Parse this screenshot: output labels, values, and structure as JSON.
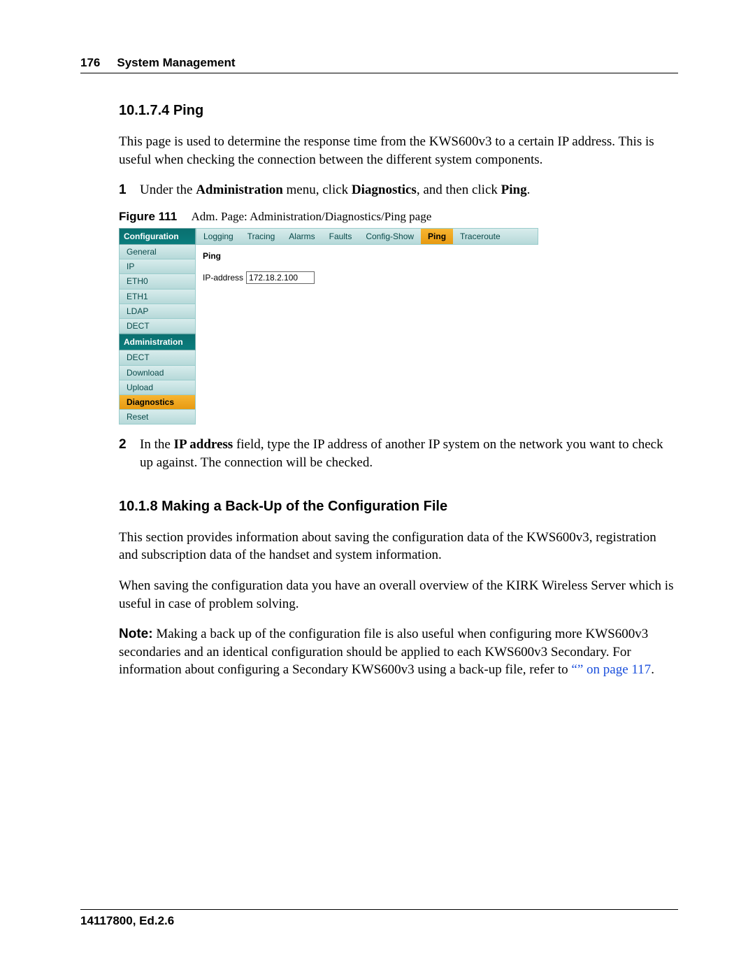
{
  "header": {
    "page_number": "176",
    "chapter_title": "System Management"
  },
  "section_ping": {
    "heading": "10.1.7.4  Ping",
    "intro": "This page is used to determine the response time from the KWS600v3 to a certain IP address. This is useful when checking the connection between the different system components.",
    "step1_pre": "Under the ",
    "step1_b1": "Administration",
    "step1_mid1": " menu, click ",
    "step1_b2": "Diagnostics",
    "step1_mid2": ", and then click ",
    "step1_b3": "Ping",
    "step1_end": ".",
    "figure_label": "Figure 111",
    "figure_caption": "Adm. Page: Administration/Diagnostics/Ping page",
    "step2_pre": "In the ",
    "step2_b": "IP address",
    "step2_post": " field, type the IP address of another IP system on the network you want to check up against. The connection will be checked."
  },
  "admin_ui": {
    "sidebar": {
      "config_header": "Configuration",
      "config_items": [
        "General",
        "IP",
        "ETH0",
        "ETH1",
        "LDAP",
        "DECT"
      ],
      "admin_header": "Administration",
      "admin_items": [
        "DECT",
        "Download",
        "Upload",
        "Diagnostics",
        "Reset"
      ],
      "selected": "Diagnostics"
    },
    "tabs": [
      "Logging",
      "Tracing",
      "Alarms",
      "Faults",
      "Config-Show",
      "Ping",
      "Traceroute"
    ],
    "active_tab": "Ping",
    "panel_title": "Ping",
    "ip_label": "IP-address",
    "ip_value": "172.18.2.100"
  },
  "section_backup": {
    "heading": "10.1.8  Making a Back-Up of the Configuration File",
    "p1": "This section provides information about saving the configuration data of the KWS600v3, registration and subscription data of the handset and system information.",
    "p2": "When saving the configuration data you have an overall overview of the KIRK Wireless Server which is useful in case of problem solving.",
    "note_label": "Note:",
    "note_body_pre": " Making a back up of the configuration file is also useful when configuring more KWS600v3 secondaries and an identical configuration should be applied to each KWS600v3 Secondary. For information about configuring a Secondary KWS600v3 using a back-up file, refer to ",
    "note_link": "“” on page 117",
    "note_end": "."
  },
  "footer": {
    "doc_id": "14117800, Ed.2.6"
  },
  "list_numbers": {
    "one": "1",
    "two": "2"
  }
}
